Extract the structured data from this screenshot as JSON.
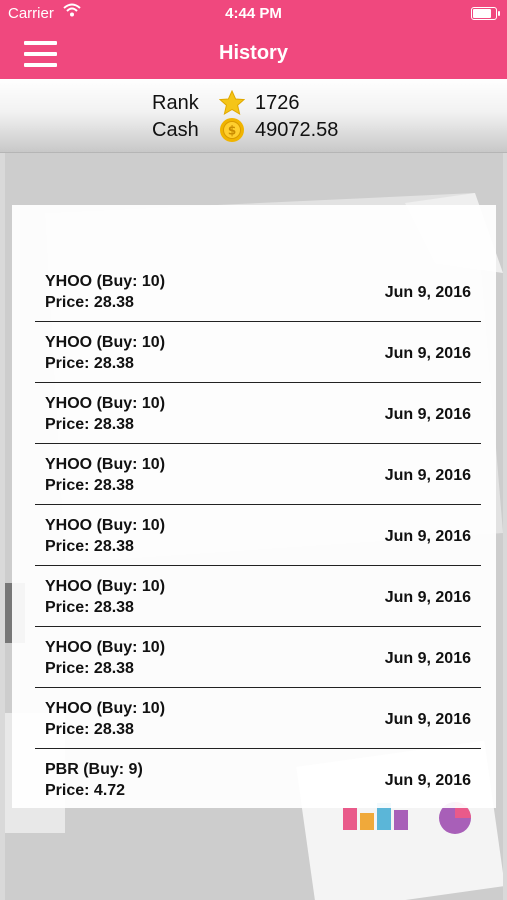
{
  "status_bar": {
    "carrier": "Carrier",
    "time": "4:44 PM"
  },
  "nav": {
    "title": "History",
    "menu_icon": "hamburger-menu-icon"
  },
  "stats": {
    "rank_label": "Rank",
    "rank_value": "1726",
    "rank_icon": "star-icon",
    "cash_label": "Cash",
    "cash_value": "49072.58",
    "cash_icon": "coin-icon"
  },
  "colors": {
    "brand": "#f0487e",
    "star": "#f5c518",
    "coin": "#f0b400"
  },
  "history": [
    {
      "title": "YHOO (Buy: 10)",
      "price": "Price: 28.38",
      "date": "Jun 9, 2016"
    },
    {
      "title": "YHOO (Buy: 10)",
      "price": "Price: 28.38",
      "date": "Jun 9, 2016"
    },
    {
      "title": "YHOO (Buy: 10)",
      "price": "Price: 28.38",
      "date": "Jun 9, 2016"
    },
    {
      "title": "YHOO (Buy: 10)",
      "price": "Price: 28.38",
      "date": "Jun 9, 2016"
    },
    {
      "title": "YHOO (Buy: 10)",
      "price": "Price: 28.38",
      "date": "Jun 9, 2016"
    },
    {
      "title": "YHOO (Buy: 10)",
      "price": "Price: 28.38",
      "date": "Jun 9, 2016"
    },
    {
      "title": "YHOO (Buy: 10)",
      "price": "Price: 28.38",
      "date": "Jun 9, 2016"
    },
    {
      "title": "YHOO (Buy: 10)",
      "price": "Price: 28.38",
      "date": "Jun 9, 2016"
    },
    {
      "title": "PBR (Buy: 9)",
      "price": "Price: 4.72",
      "date": "Jun 9, 2016"
    }
  ]
}
